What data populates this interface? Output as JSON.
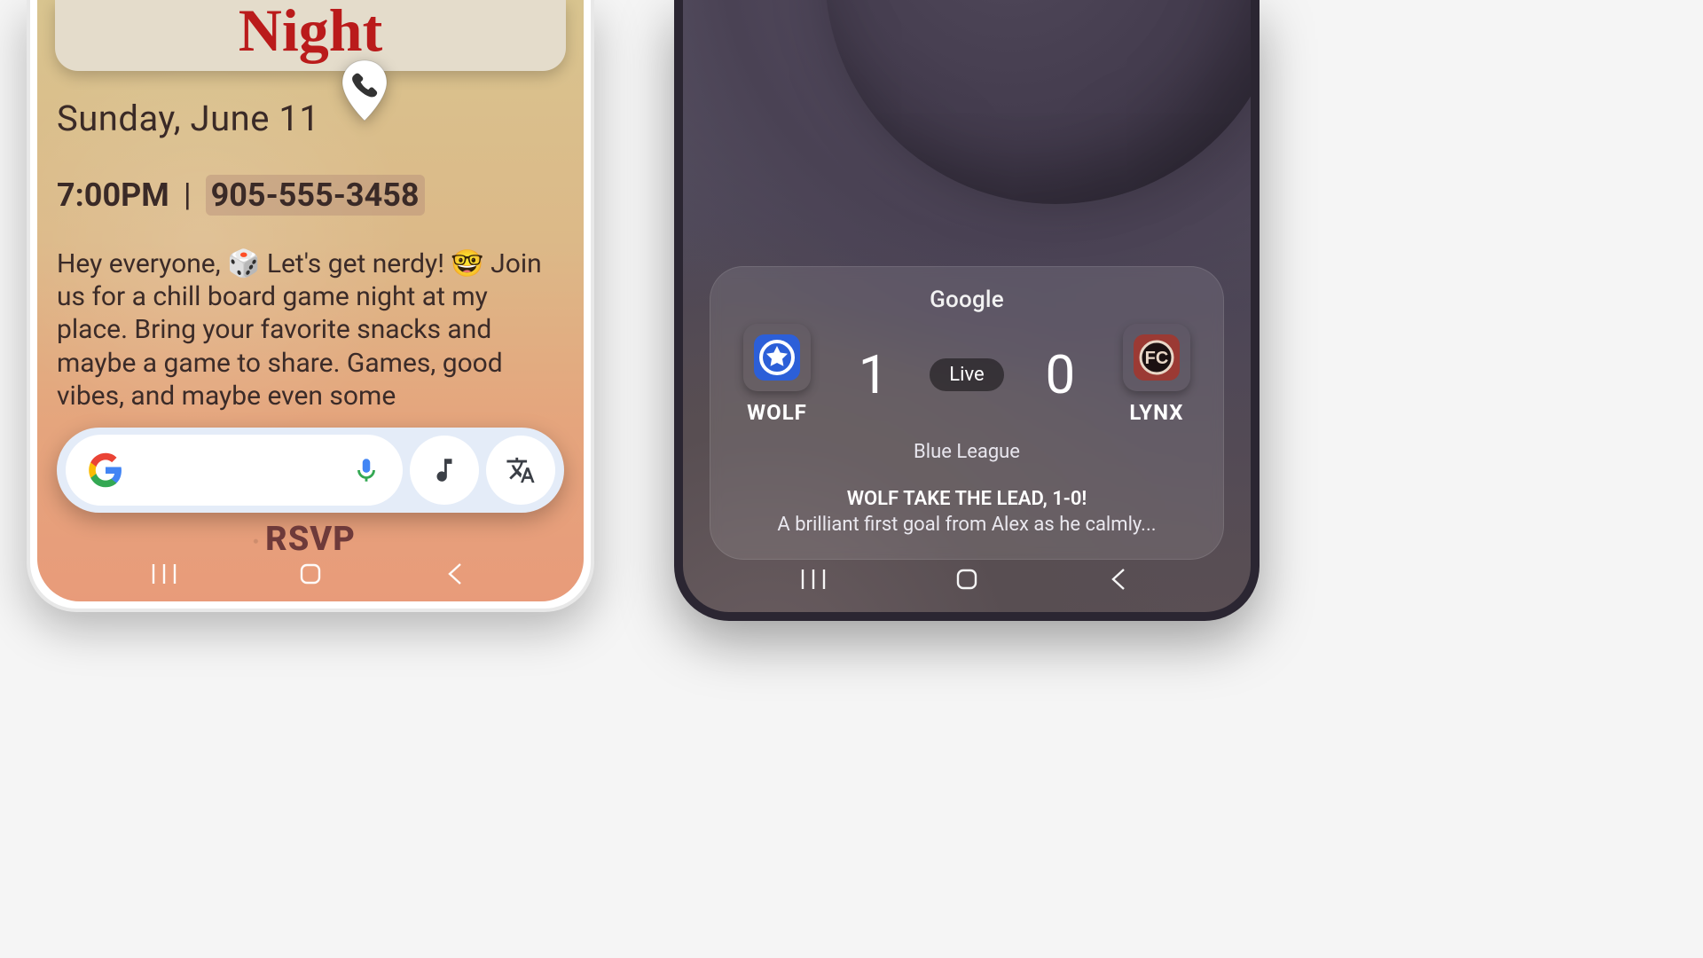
{
  "phone1": {
    "poster_title": "Night",
    "date_line": "Sunday, June 11",
    "time": "7:00PM",
    "separator": "|",
    "phone_number": "905-555-3458",
    "description": "Hey everyone, 🎲 Let's get nerdy! 🤓 Join us for a chill board game night at my place. Bring your favorite snacks and maybe a game to share. Games, good vibes, and maybe even some",
    "rsvp": "RSVP"
  },
  "search": {
    "google_icon": "google-g-icon",
    "mic_icon": "mic-icon",
    "music_icon": "music-note-icon",
    "translate_icon": "translate-icon"
  },
  "phone2": {
    "brand": "Google",
    "team_a": {
      "abbr": "WOLF",
      "score": "1",
      "badge_color": "#2c5fd8"
    },
    "team_b": {
      "abbr": "LYNX",
      "score": "0",
      "badge_color": "#9b3a34"
    },
    "status": "Live",
    "league": "Blue League",
    "headline": "WOLF TAKE THE LEAD, 1-0!",
    "subline": "A brilliant first goal from Alex as he calmly..."
  },
  "nav": {
    "recents": "recents",
    "home": "home",
    "back": "back"
  }
}
